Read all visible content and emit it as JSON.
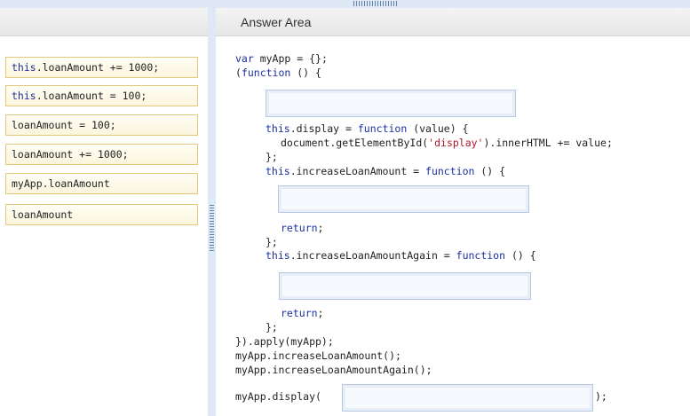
{
  "answer_area": {
    "title": "Answer Area"
  },
  "tiles": [
    {
      "kw": "this",
      "rest": ".loanAmount += 1000;"
    },
    {
      "kw": "this",
      "rest": ".loanAmount = 100;"
    },
    {
      "kw": "",
      "rest": "loanAmount = 100;"
    },
    {
      "kw": "",
      "rest": "loanAmount += 1000;"
    },
    {
      "kw": "",
      "rest": "myApp.loanAmount"
    },
    {
      "kw": "",
      "rest": "loanAmount"
    }
  ],
  "code": {
    "l1": {
      "a": "var",
      "b": " myApp = {};"
    },
    "l2": {
      "a": "(",
      "b": "function",
      "c": " () {"
    },
    "l3": {
      "a": "this",
      "b": ".display = ",
      "c": "function",
      "d": " (value) {"
    },
    "l4": {
      "a": "document.getElementById(",
      "b": "'display'",
      "c": ").innerHTML += value;"
    },
    "l5": "};",
    "l6": {
      "a": "this",
      "b": ".increaseLoanAmount = ",
      "c": "function",
      "d": " () {"
    },
    "l7": {
      "a": "return",
      "b": ";"
    },
    "l8": "};",
    "l9": {
      "a": "this",
      "b": ".increaseLoanAmountAgain = ",
      "c": "function",
      "d": " () {"
    },
    "l10": {
      "a": "return",
      "b": ";"
    },
    "l11": "};",
    "l12": "}).apply(myApp);",
    "l13": "myApp.increaseLoanAmount();",
    "l14": "myApp.increaseLoanAmountAgain();",
    "l15a": "myApp.display(",
    "l15b": ");"
  }
}
